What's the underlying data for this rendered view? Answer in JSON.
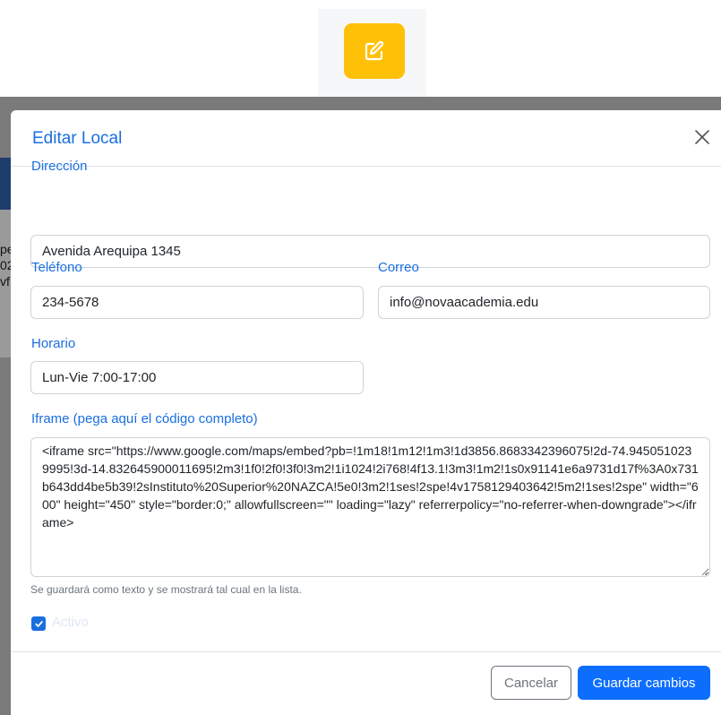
{
  "backdrop": {
    "fragments": [
      "pe",
      "02",
      "vf"
    ]
  },
  "modal": {
    "title": "Editar Local",
    "direccion": {
      "label": "Dirección",
      "value": "Avenida Arequipa 1345"
    },
    "telefono": {
      "label": "Teléfono",
      "value": "234-5678"
    },
    "correo": {
      "label": "Correo",
      "value": "info@novaacademia.edu"
    },
    "horario": {
      "label": "Horario",
      "value": "Lun-Vie 7:00-17:00"
    },
    "iframe": {
      "label": "Iframe (pega aquí el código completo)",
      "value": "<iframe src=\"https://www.google.com/maps/embed?pb=!1m18!1m12!1m3!1d3856.8683342396075!2d-74.9450510239995!3d-14.832645900011695!2m3!1f0!2f0!3f0!3m2!1i1024!2i768!4f13.1!3m3!1m2!1s0x91141e6a9731d17f%3A0x731b643dd4be5b39!2sInstituto%20Superior%20NAZCA!5e0!3m2!1ses!2spe!4v1758129403642!5m2!1ses!2spe\" width=\"600\" height=\"450\" style=\"border:0;\" allowfullscreen=\"\" loading=\"lazy\" referrerpolicy=\"no-referrer-when-downgrade\"></iframe>",
      "help": "Se guardará como texto y se mostrará tal cual en la lista."
    },
    "activo": {
      "label": "Activo",
      "checked": true
    },
    "footer": {
      "cancel_label": "Cancelar",
      "save_label": "Guardar cambios"
    }
  },
  "icons": {
    "edit": "edit-icon",
    "close": "close-icon",
    "check": "check-icon"
  },
  "colors": {
    "edit_button": "#ffc107",
    "primary": "#0d6efd",
    "label": "#1a6fe0",
    "backdrop": "#7a7a7a"
  }
}
